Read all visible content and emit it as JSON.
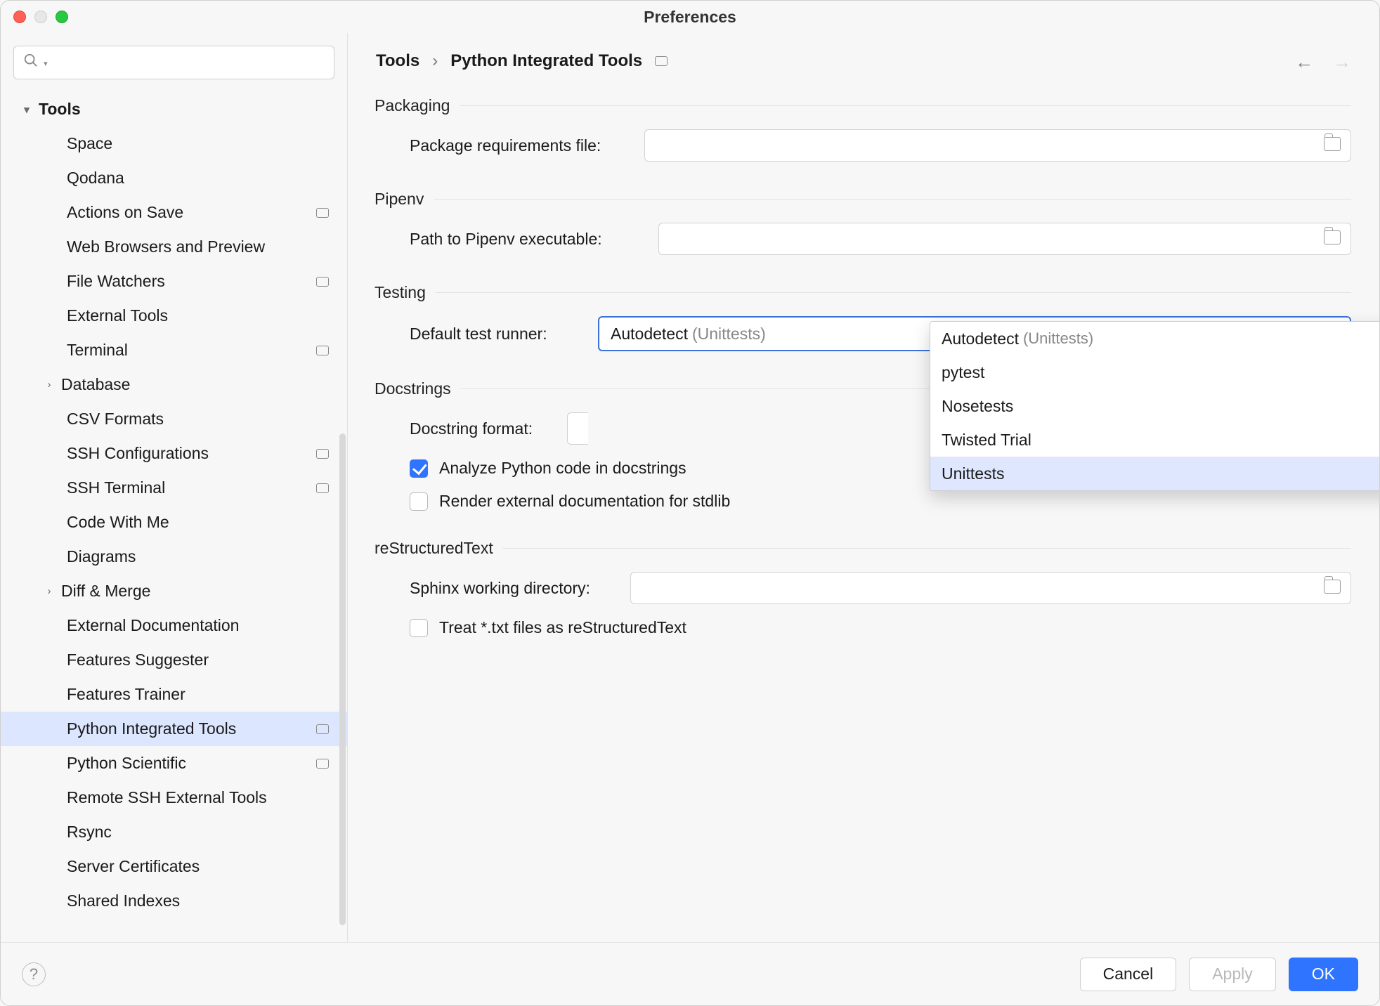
{
  "window": {
    "title": "Preferences"
  },
  "search": {
    "placeholder": ""
  },
  "sidebar": {
    "root_label": "Tools",
    "items": [
      {
        "label": "Space",
        "badge": false
      },
      {
        "label": "Qodana",
        "badge": false
      },
      {
        "label": "Actions on Save",
        "badge": true
      },
      {
        "label": "Web Browsers and Preview",
        "badge": false
      },
      {
        "label": "File Watchers",
        "badge": true
      },
      {
        "label": "External Tools",
        "badge": false
      },
      {
        "label": "Terminal",
        "badge": true
      },
      {
        "label": "Database",
        "badge": false,
        "expandable": true
      },
      {
        "label": "CSV Formats",
        "badge": false
      },
      {
        "label": "SSH Configurations",
        "badge": true
      },
      {
        "label": "SSH Terminal",
        "badge": true
      },
      {
        "label": "Code With Me",
        "badge": false
      },
      {
        "label": "Diagrams",
        "badge": false
      },
      {
        "label": "Diff & Merge",
        "badge": false,
        "expandable": true
      },
      {
        "label": "External Documentation",
        "badge": false
      },
      {
        "label": "Features Suggester",
        "badge": false
      },
      {
        "label": "Features Trainer",
        "badge": false
      },
      {
        "label": "Python Integrated Tools",
        "badge": true,
        "selected": true
      },
      {
        "label": "Python Scientific",
        "badge": true
      },
      {
        "label": "Remote SSH External Tools",
        "badge": false
      },
      {
        "label": "Rsync",
        "badge": false
      },
      {
        "label": "Server Certificates",
        "badge": false
      },
      {
        "label": "Shared Indexes",
        "badge": false
      }
    ]
  },
  "breadcrumb": {
    "part1": "Tools",
    "sep": "›",
    "part2": "Python Integrated Tools"
  },
  "sections": {
    "packaging": {
      "legend": "Packaging",
      "req_label": "Package requirements file:"
    },
    "pipenv": {
      "legend": "Pipenv",
      "path_label": "Path to Pipenv executable:"
    },
    "testing": {
      "legend": "Testing",
      "runner_label": "Default test runner:",
      "selected_main": "Autodetect",
      "selected_sub": "(Unittests)"
    },
    "docstrings": {
      "legend": "Docstrings",
      "format_label": "Docstring format:",
      "chk1": "Analyze Python code in docstrings",
      "chk2": "Render external documentation for stdlib"
    },
    "rst": {
      "legend": "reStructuredText",
      "sphinx_label": "Sphinx working directory:",
      "chk": "Treat *.txt files as reStructuredText"
    }
  },
  "dropdown": {
    "options": [
      {
        "main": "Autodetect",
        "sub": "(Unittests)"
      },
      {
        "main": "pytest"
      },
      {
        "main": "Nosetests"
      },
      {
        "main": "Twisted Trial"
      },
      {
        "main": "Unittests",
        "hover": true
      }
    ]
  },
  "footer": {
    "cancel": "Cancel",
    "apply": "Apply",
    "ok": "OK"
  }
}
